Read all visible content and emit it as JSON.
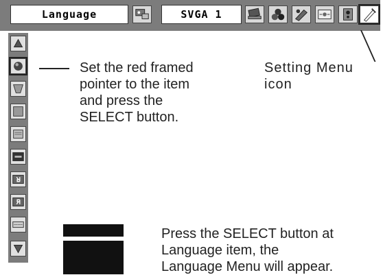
{
  "topbar": {
    "menu_title": "Language",
    "input_mode": "SVGA 1",
    "icons": [
      "screen-adjust-icon",
      "pc-adjust-icon",
      "image-select-icon",
      "color-adjust-icon",
      "image-adjust-icon",
      "sound-icon",
      "setting-menu-icon"
    ]
  },
  "sidebar": {
    "icons": [
      "scroll-up-icon",
      "language-icon",
      "keystone-icon",
      "blue-back-icon",
      "display-icon",
      "logo-icon",
      "ceiling-icon",
      "rear-icon",
      "terminal-icon",
      "scroll-down-icon"
    ]
  },
  "callouts": {
    "pointer_instruction": [
      "Set the red framed",
      "pointer to the item",
      "and press the",
      "SELECT button."
    ],
    "setting_menu_label": [
      "Setting Menu",
      "icon"
    ],
    "language_instruction": [
      "Press the SELECT button at",
      "Language item, the",
      "Language Menu will appear."
    ]
  }
}
